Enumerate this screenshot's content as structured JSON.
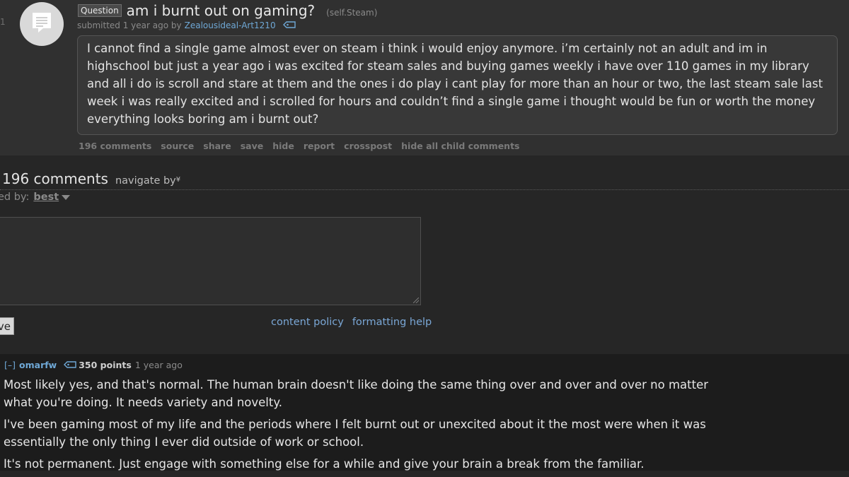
{
  "post": {
    "rank": "1",
    "thumbnail_icon": "self-post-text-icon",
    "flair": "Question",
    "title": "am i burnt out on gaming?",
    "domain": "(self.Steam)",
    "submitted_text": "submitted 1 year ago by",
    "author": "Zealousideal-Art1210",
    "body": "I cannot find a single game almost ever on steam i think i would enjoy anymore. i’m certainly not an adult and im in highschool but just a year ago i was excited for steam sales and buying games weekly i have over 110 games in my library and all i do is scroll and stare at them and the ones i do play i cant play for more than an hour or two, the last steam sale last week i was really excited and i scrolled for hours and couldn’t find a single game i thought would be fun or worth the money everything looks boring am i burnt out?",
    "buttons": {
      "comments": "196 comments",
      "source": "source",
      "share": "share",
      "save": "save",
      "hide": "hide",
      "report": "report",
      "crosspost": "crosspost",
      "hide_children": "hide all child comments"
    }
  },
  "comments_area": {
    "count_label": "196 comments",
    "navigate_label": "navigate by",
    "navigate_icon": "double-chevron-down-icon",
    "sorted_label": "ed by:",
    "sort_value": "best",
    "save_button": "ve",
    "content_policy": "content policy",
    "formatting_help": "formatting help"
  },
  "comment": {
    "expand": "[–]",
    "author": "omarfw",
    "points": "350 points",
    "time": "1 year ago",
    "paragraphs": [
      "Most likely yes, and that's normal. The human brain doesn't like doing the same thing over and over and over no matter what you're doing. It needs variety and novelty.",
      "I've been gaming most of my life and the periods where I felt burnt out or unexcited about it the most were when it was essentially the only thing I ever did outside of work or school.",
      "It's not permanent. Just engage with something else for a while and give your brain a break from the familiar."
    ]
  },
  "colors": {
    "link_blue": "#6fa8d6",
    "post_bg": "#303030",
    "page_bg": "#262626",
    "comment_bg": "#1c1c1c"
  }
}
